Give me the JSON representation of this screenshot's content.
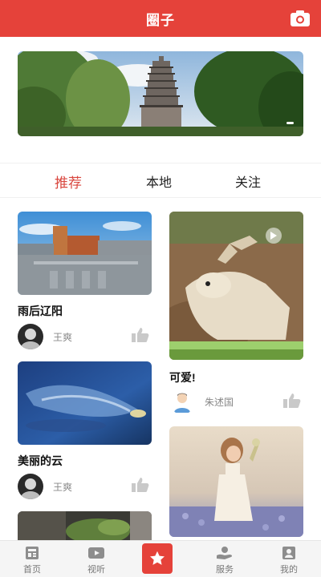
{
  "header": {
    "title": "圈子",
    "camera_icon": "camera-icon"
  },
  "tabs": [
    {
      "label": "推荐",
      "active": true
    },
    {
      "label": "本地",
      "active": false
    },
    {
      "label": "关注",
      "active": false
    }
  ],
  "feed": {
    "left": [
      {
        "title": "雨后辽阳",
        "author": "王爽",
        "image": "rainy-street-photo"
      },
      {
        "title": "美丽的云",
        "author": "王爽",
        "image": "night-cloud-photo"
      },
      {
        "title": "",
        "author": "",
        "image": "plant-photo-partial"
      }
    ],
    "right": [
      {
        "title": "可爱!",
        "author": "朱述国",
        "image": "deer-video-thumbnail",
        "has_video": true
      },
      {
        "title": "",
        "author": "",
        "image": "girl-in-flower-field-photo"
      }
    ]
  },
  "bottom_nav": [
    {
      "label": "首页",
      "icon": "home-icon"
    },
    {
      "label": "视听",
      "icon": "video-icon"
    },
    {
      "label": "",
      "icon": "star-icon",
      "active": true
    },
    {
      "label": "服务",
      "icon": "service-hand-icon"
    },
    {
      "label": "我的",
      "icon": "profile-icon"
    }
  ],
  "colors": {
    "brand": "#e5423a",
    "active_tab": "#d9473f",
    "muted_text": "#888888"
  }
}
